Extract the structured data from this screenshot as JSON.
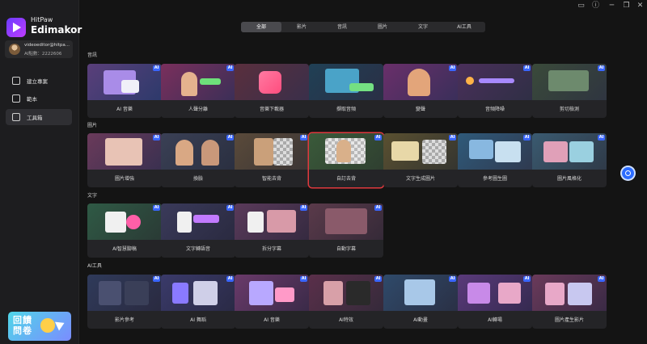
{
  "sidebar": {
    "brand_small": "HitPaw",
    "brand_big": "Edimakor",
    "account_email": "videoeditor@hitpa...",
    "account_points": "AI點數：2222606",
    "nav": [
      {
        "label": "建立專案",
        "icon": "monitor-icon"
      },
      {
        "label": "範本",
        "icon": "template-icon"
      },
      {
        "label": "工具箱",
        "icon": "toolbox-icon"
      }
    ],
    "promo_text": "回饋問卷"
  },
  "window_controls": [
    "feedback-icon",
    "help-icon",
    "minimize-icon",
    "restore-icon",
    "close-icon"
  ],
  "tabs": [
    "全部",
    "影片",
    "音訊",
    "圖片",
    "文字",
    "AI工具"
  ],
  "active_tab": "全部",
  "ai_badge": "AI",
  "sections": [
    {
      "title": "音訊",
      "cards": [
        {
          "label": "AI 音樂",
          "ai": true
        },
        {
          "label": "人聲分離",
          "ai": true
        },
        {
          "label": "音樂下載器",
          "ai": false
        },
        {
          "label": "擷取音頻",
          "ai": false
        },
        {
          "label": "變聲",
          "ai": true
        },
        {
          "label": "音頻降噪",
          "ai": true
        },
        {
          "label": "剪切檢測",
          "ai": true
        }
      ]
    },
    {
      "title": "圖片",
      "cards": [
        {
          "label": "圖片增強",
          "ai": true
        },
        {
          "label": "換臉",
          "ai": true
        },
        {
          "label": "智能去背",
          "ai": true
        },
        {
          "label": "自訂去背",
          "ai": true,
          "selected": true
        },
        {
          "label": "文字生成圖片",
          "ai": true
        },
        {
          "label": "參考圖生圖",
          "ai": true
        },
        {
          "label": "圖片風格化",
          "ai": true
        }
      ]
    },
    {
      "title": "文字",
      "cards": [
        {
          "label": "AI智慧腳稿",
          "ai": true
        },
        {
          "label": "文字轉語音",
          "ai": true
        },
        {
          "label": "拆分字幕",
          "ai": true
        },
        {
          "label": "自動字幕",
          "ai": true
        }
      ]
    },
    {
      "title": "AI工具",
      "cards": [
        {
          "label": "影片參考",
          "ai": true
        },
        {
          "label": "AI 舞蹈",
          "ai": true
        },
        {
          "label": "AI 音樂",
          "ai": true
        },
        {
          "label": "AI特效",
          "ai": true
        },
        {
          "label": "AI動畫",
          "ai": true
        },
        {
          "label": "AI轉場",
          "ai": true
        },
        {
          "label": "圖片產生影片",
          "ai": true
        }
      ]
    }
  ],
  "colors": {
    "background": "#141414",
    "sidebar": "#1d1d1f",
    "card": "#242427",
    "accent_ai_badge": "#3a66ff",
    "selection_border": "#e0393e"
  }
}
